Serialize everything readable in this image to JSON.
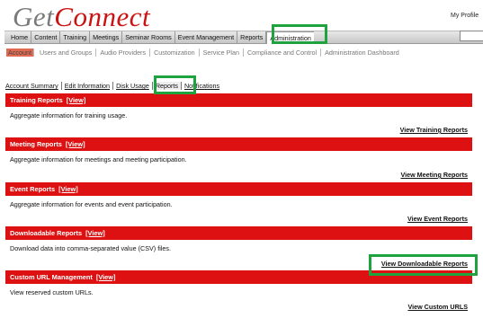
{
  "logo": {
    "get": "Get",
    "connect": "Connect"
  },
  "profile_link": "My Profile",
  "main_nav": [
    "Home",
    "Content",
    "Training",
    "Meetings",
    "Seminar Rooms",
    "Event Management",
    "Reports",
    "Administration"
  ],
  "sub_nav": [
    "Account",
    "Users and Groups",
    "Audio Providers",
    "Customization",
    "Service Plan",
    "Compliance and Control",
    "Administration Dashboard"
  ],
  "tabs": [
    "Account Summary",
    "Edit Information",
    "Disk Usage",
    "Reports",
    "Notifications"
  ],
  "sections": [
    {
      "title": "Training Reports",
      "view": "[View]",
      "desc": "Aggregate information for training usage.",
      "link": "View Training Reports"
    },
    {
      "title": "Meeting Reports",
      "view": "[View]",
      "desc": "Aggregate information for meetings and meeting participation.",
      "link": "View Meeting Reports"
    },
    {
      "title": "Event Reports",
      "view": "[View]",
      "desc": "Aggregate information for events and event participation.",
      "link": "View Event Reports"
    },
    {
      "title": "Downloadable Reports",
      "view": "[View]",
      "desc": "Download data into comma-separated value (CSV) files.",
      "link": "View Downloadable Reports"
    },
    {
      "title": "Custom URL Management",
      "view": "[View]",
      "desc": "View reserved custom URLs.",
      "link": "View Custom URLS"
    }
  ],
  "colors": {
    "brand_red": "#dd1111",
    "highlight_green": "#1ea33f"
  }
}
